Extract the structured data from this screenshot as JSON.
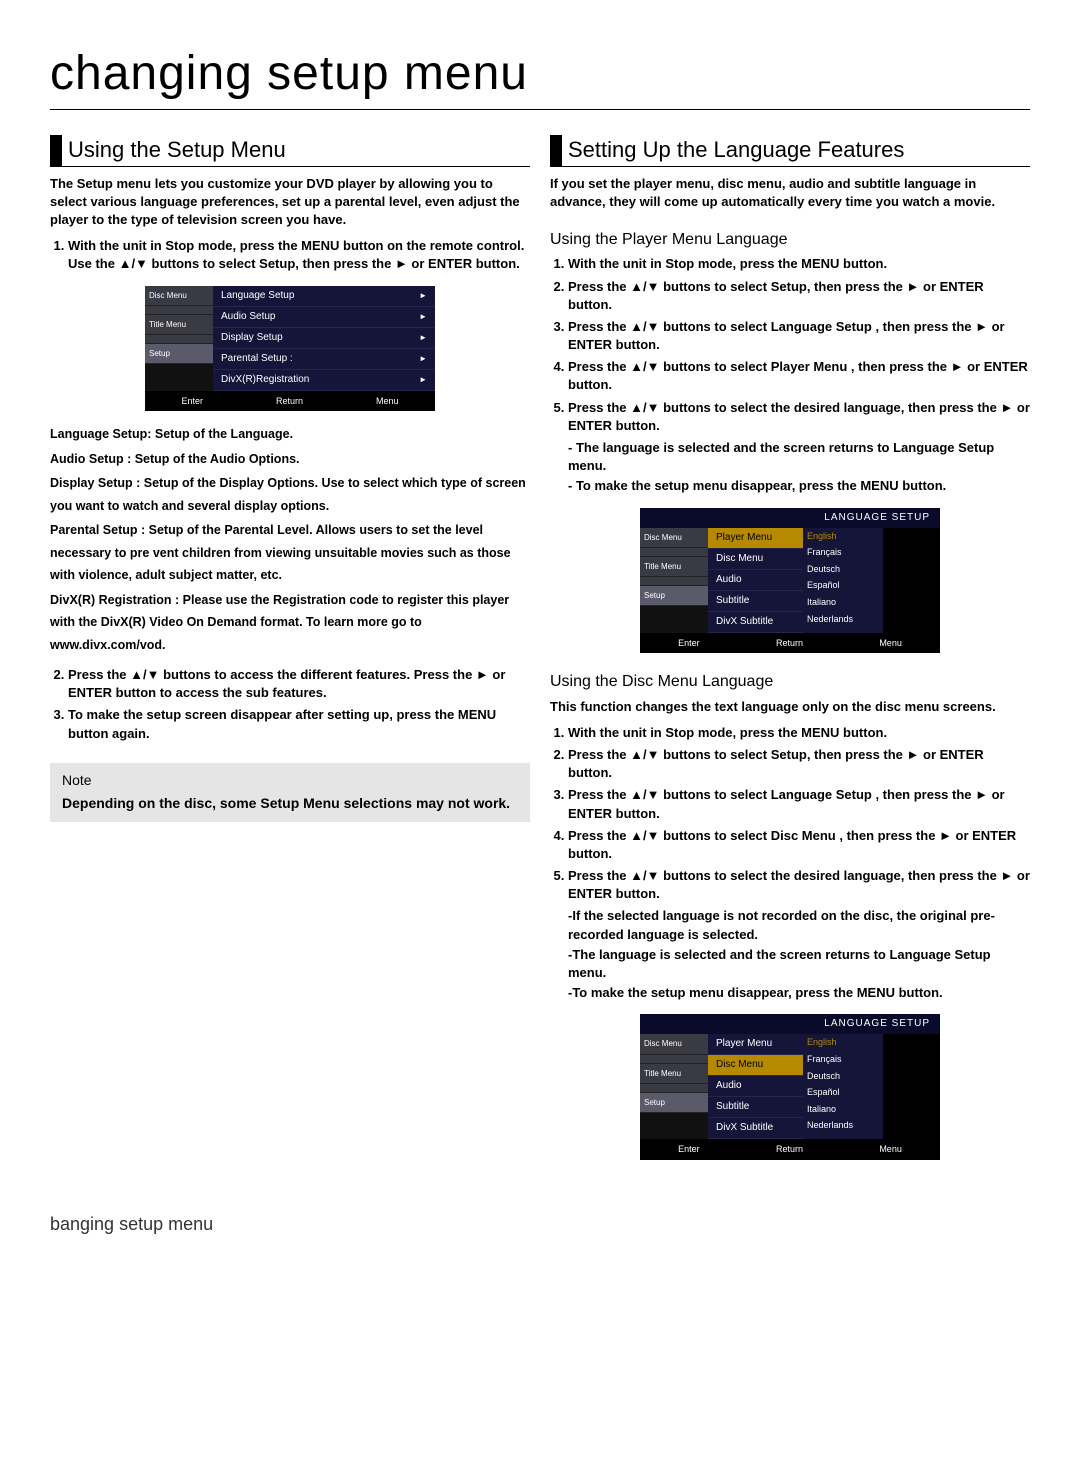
{
  "title": "changing setup menu",
  "left": {
    "heading": "Using the Setup Menu",
    "intro": "The Setup menu lets you customize your DVD player by allowing you to select various language preferences, set up a parental level, even adjust the player to the type of television screen you have.",
    "step1": "With the unit in Stop mode, press the MENU button on the remote control. Use the ▲/▼ buttons to select Setup, then press the ► or ENTER button.",
    "defs": {
      "a": "Language Setup: Setup of the Language.",
      "b": "Audio Setup : Setup of the Audio Options.",
      "c": "Display Setup : Setup of the Display Options. Use to select which type of screen you want to watch and several display options.",
      "d": "Parental Setup : Setup of the Parental Level. Allows users to set the level necessary to pre vent children from viewing unsuitable movies such as those with violence, adult subject matter, etc.",
      "e": "DivX(R) Registration : Please use the Registration code to register this player with the DivX(R) Video On Demand format. To learn more go to www.divx.com/vod."
    },
    "step2": "Press the ▲/▼ buttons to access the different features. Press the ► or ENTER button to access the sub features.",
    "step3": "To make the setup screen disappear after setting up, press the MENU button again.",
    "note_title": "Note",
    "note_body": "Depending on the disc, some Setup Menu selections may not work."
  },
  "right": {
    "heading": "Setting Up the Language Features",
    "intro": "If you set the player menu, disc menu, audio and subtitle language in advance, they will come up automatically every time you watch a movie.",
    "sub1": "Using the Player Menu Language",
    "s1": {
      "a": "With the unit in Stop mode, press the MENU button.",
      "b": "Press the ▲/▼ buttons to select Setup, then press the ► or ENTER button.",
      "c": "Press the ▲/▼ buttons to select Language Setup , then press the ► or ENTER button.",
      "d": "Press the ▲/▼ buttons to select Player Menu , then press the ► or ENTER button.",
      "e": "Press the ▲/▼ buttons to select the desired language, then press the ► or ENTER button.",
      "e1": "- The language is selected and the screen returns to Language Setup menu.",
      "e2": "- To make the setup menu disappear, press the MENU button."
    },
    "sub2": "Using the Disc Menu Language",
    "sub2_intro": "This function changes the text language only on the disc menu screens.",
    "s2": {
      "a": "With the unit in Stop mode, press the MENU button.",
      "b": "Press the ▲/▼ buttons to select Setup, then press the ► or ENTER button.",
      "c": "Press the ▲/▼ buttons to select Language Setup , then press the ► or ENTER button.",
      "d": "Press the ▲/▼ buttons to select Disc Menu , then press the ► or ENTER button.",
      "e": "Press the ▲/▼ buttons to select the desired language, then press the ► or ENTER button.",
      "e1": "-If the selected language is not recorded on the disc, the original pre-recorded language is selected.",
      "e2": "-The language is selected and the screen returns to Language Setup menu.",
      "e3": "-To make the setup menu disappear, press the MENU button."
    }
  },
  "osd1": {
    "side": [
      "Disc Menu",
      "",
      "Title Menu",
      "",
      "Setup"
    ],
    "items": [
      "Language Setup",
      "Audio Setup",
      "Display Setup",
      "Parental Setup :",
      "DivX(R)Registration"
    ],
    "foot": [
      "Enter",
      "Return",
      "Menu"
    ]
  },
  "osd2": {
    "head": "LANGUAGE SETUP",
    "side": [
      "Disc Menu",
      "",
      "Title Menu",
      "",
      "Setup"
    ],
    "mid": [
      "Player Menu",
      "Disc Menu",
      "Audio",
      "Subtitle",
      "DivX Subtitle"
    ],
    "opts": [
      "English",
      "Français",
      "Deutsch",
      "Español",
      "Italiano",
      "Nederlands"
    ],
    "foot": [
      "Enter",
      "Return",
      "Menu"
    ]
  },
  "footer": "banging setup menu"
}
